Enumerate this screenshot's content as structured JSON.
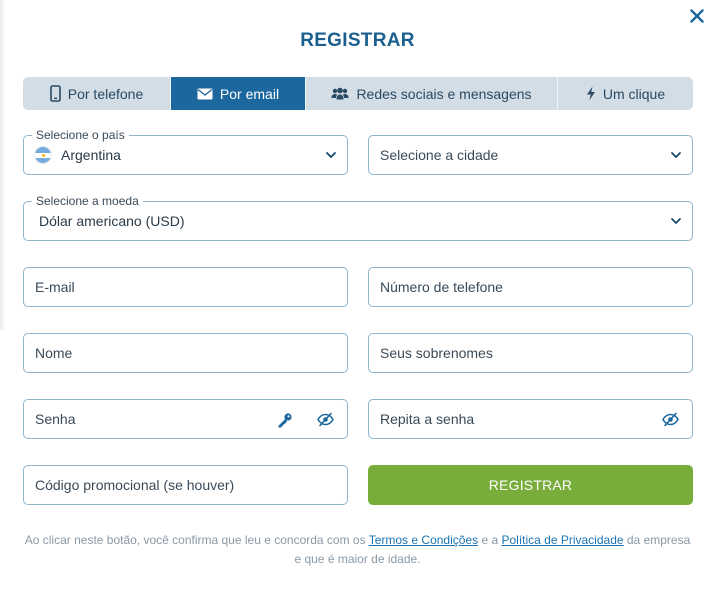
{
  "title": "REGISTRAR",
  "tabs": [
    {
      "label": "Por telefone",
      "icon": "phone-icon",
      "active": false
    },
    {
      "label": "Por email",
      "icon": "envelope-icon",
      "active": true
    },
    {
      "label": "Redes sociais e mensagens",
      "icon": "users-icon",
      "active": false
    },
    {
      "label": "Um clique",
      "icon": "lightning-icon",
      "active": false
    }
  ],
  "country": {
    "label": "Selecione o país",
    "value": "Argentina"
  },
  "city": {
    "placeholder": "Selecione a cidade"
  },
  "currency": {
    "label": "Selecione a moeda",
    "value": "Dólar americano (USD)"
  },
  "fields": {
    "email": "E-mail",
    "phone": "Número de telefone",
    "name": "Nome",
    "surname": "Seus sobrenomes",
    "password": "Senha",
    "repeat_password": "Repita a senha",
    "promo": "Código promocional (se houver)"
  },
  "register_button": "REGISTRAR",
  "legal": {
    "prefix": "Ao clicar neste botão, você confirma que leu e concorda com os ",
    "terms": "Termos e Condições",
    "middle": " e a ",
    "privacy": "Política de Privacidade",
    "suffix": " da empresa e que é maior de idade."
  },
  "colors": {
    "accent": "#1b679e",
    "title": "#1a5f8e",
    "register": "#78ad3c",
    "border": "#8fb5cf",
    "link": "#1b73b3"
  }
}
